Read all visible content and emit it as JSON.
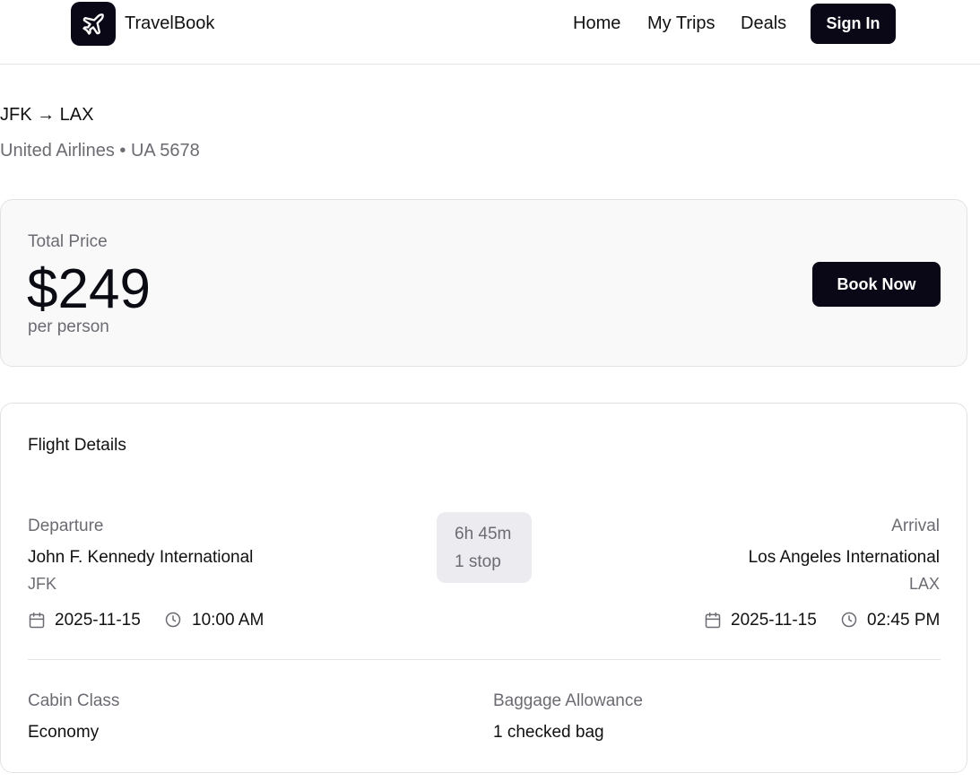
{
  "header": {
    "brand": "TravelBook",
    "nav": [
      "Home",
      "My Trips",
      "Deals"
    ],
    "sign_in": "Sign In",
    "logo_icon": "plane-icon"
  },
  "flight": {
    "route": "JFK → LAX",
    "airline_line": "United Airlines • UA 5678"
  },
  "price_card": {
    "label": "Total Price",
    "price": "$249",
    "unit": "per person",
    "book_button": "Book Now"
  },
  "details": {
    "title": "Flight Details",
    "departure": {
      "label": "Departure",
      "airport": "John F. Kennedy International",
      "code": "JFK",
      "date": "2025-11-15",
      "time": "10:00 AM"
    },
    "arrival": {
      "label": "Arrival",
      "airport": "Los Angeles International",
      "code": "LAX",
      "date": "2025-11-15",
      "time": "02:45 PM"
    },
    "duration": "6h 45m",
    "stops": "1 stop",
    "cabin_label": "Cabin Class",
    "cabin_value": "Economy",
    "baggage_label": "Baggage Allowance",
    "baggage_value": "1 checked bag"
  },
  "colors": {
    "primary": "#0a0816",
    "muted_text": "#6b6b72",
    "card_bg": "#f9f9fa",
    "border": "#e3e3e6"
  }
}
